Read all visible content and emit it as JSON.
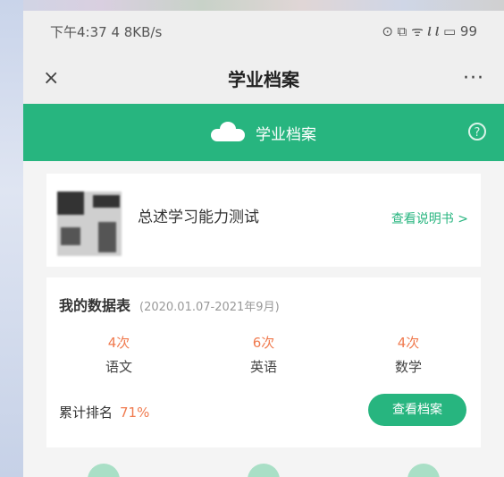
{
  "statusbar": {
    "left": "下午4:37 4 8KB/s",
    "right": "⊙ ⧉ ᯤ 𝒍 𝒍 ▭ 99"
  },
  "topbar": {
    "close_icon": "×",
    "title": "学业档案",
    "more_icon": "···"
  },
  "greenbar": {
    "label": "学业档案",
    "icon": "cloud-icon",
    "info": "?"
  },
  "profile": {
    "name": "总述学习能力测试",
    "link_text": "查看说明书 >",
    "qr_icon": "qr-code-icon"
  },
  "report": {
    "heading": "我的数据表",
    "subheading": "(2020.01.07-2021年9月)",
    "stats": [
      {
        "value": "4次",
        "label": "语文"
      },
      {
        "value": "6次",
        "label": "英语"
      },
      {
        "value": "4次",
        "label": "数学"
      }
    ],
    "total_label": "累计排名",
    "total_value": "71%",
    "button_label": "查看档案"
  },
  "colors": {
    "accent": "#27b57f",
    "highlight": "#f07a4e"
  }
}
